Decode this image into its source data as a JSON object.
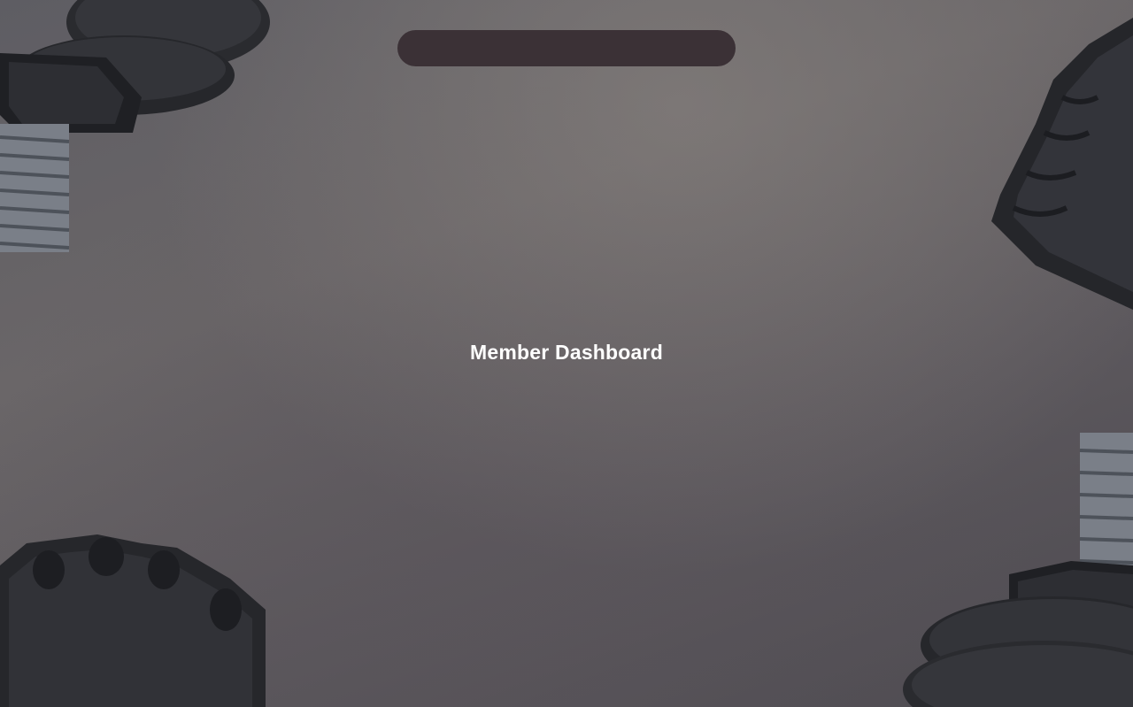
{
  "main": {
    "title": "Member Dashboard"
  },
  "header": {
    "pill_color": "#3b3136"
  },
  "background": {
    "theme": "gym-equipment-photo",
    "items": [
      "dumbbell",
      "fitness-glove",
      "fitness-glove",
      "dumbbell"
    ]
  }
}
